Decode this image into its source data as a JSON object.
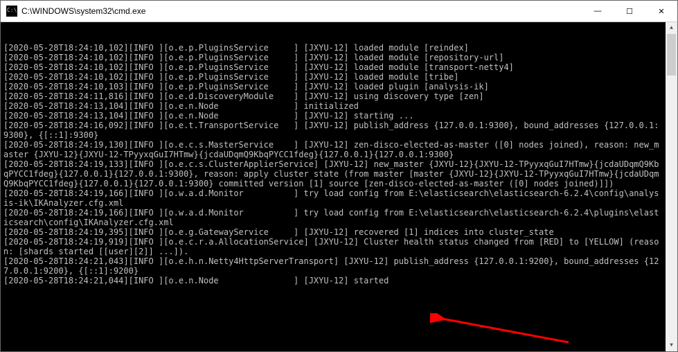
{
  "window": {
    "title": "C:\\WINDOWS\\system32\\cmd.exe",
    "controls": {
      "minimize": "—",
      "maximize": "☐",
      "close": "✕"
    }
  },
  "console": {
    "lines": [
      "[2020-05-28T18:24:10,102][INFO ][o.e.p.PluginsService     ] [JXYU-12] loaded module [reindex]",
      "[2020-05-28T18:24:10,102][INFO ][o.e.p.PluginsService     ] [JXYU-12] loaded module [repository-url]",
      "[2020-05-28T18:24:10,102][INFO ][o.e.p.PluginsService     ] [JXYU-12] loaded module [transport-netty4]",
      "[2020-05-28T18:24:10,102][INFO ][o.e.p.PluginsService     ] [JXYU-12] loaded module [tribe]",
      "[2020-05-28T18:24:10,103][INFO ][o.e.p.PluginsService     ] [JXYU-12] loaded plugin [analysis-ik]",
      "[2020-05-28T18:24:11,816][INFO ][o.e.d.DiscoveryModule    ] [JXYU-12] using discovery type [zen]",
      "[2020-05-28T18:24:13,104][INFO ][o.e.n.Node               ] initialized",
      "[2020-05-28T18:24:13,104][INFO ][o.e.n.Node               ] [JXYU-12] starting ...",
      "[2020-05-28T18:24:16,092][INFO ][o.e.t.TransportService   ] [JXYU-12] publish_address {127.0.0.1:9300}, bound_addresses {127.0.0.1:9300}, {[::1]:9300}",
      "[2020-05-28T18:24:19,130][INFO ][o.e.c.s.MasterService    ] [JXYU-12] zen-disco-elected-as-master ([0] nodes joined), reason: new_master {JXYU-12}{JXYU-12-TPyyxqGuI7HTmw}{jcdaUDqmQ9KbqPYCC1fdeg}{127.0.0.1}{127.0.0.1:9300}",
      "[2020-05-28T18:24:19,133][INFO ][o.e.c.s.ClusterApplierService] [JXYU-12] new_master {JXYU-12}{JXYU-12-TPyyxqGuI7HTmw}{jcdaUDqmQ9KbqPYCC1fdeg}{127.0.0.1}{127.0.0.1:9300}, reason: apply cluster state (from master [master {JXYU-12}{JXYU-12-TPyyxqGuI7HTmw}{jcdaUDqmQ9KbqPYCC1fdeg}{127.0.0.1}{127.0.0.1:9300} committed version [1] source [zen-disco-elected-as-master ([0] nodes joined)]])",
      "[2020-05-28T18:24:19,166][INFO ][o.w.a.d.Monitor          ] try load config from E:\\elasticsearch\\elasticsearch-6.2.4\\config\\analysis-ik\\IKAnalyzer.cfg.xml",
      "[2020-05-28T18:24:19,166][INFO ][o.w.a.d.Monitor          ] try load config from E:\\elasticsearch\\elasticsearch-6.2.4\\plugins\\elasticsearch\\config\\IKAnalyzer.cfg.xml",
      "[2020-05-28T18:24:19,395][INFO ][o.e.g.GatewayService     ] [JXYU-12] recovered [1] indices into cluster_state",
      "[2020-05-28T18:24:19,919][INFO ][o.e.c.r.a.AllocationService] [JXYU-12] Cluster health status changed from [RED] to [YELLOW] (reason: [shards started [[user][2]] ...]).",
      "[2020-05-28T18:24:21,043][INFO ][o.e.h.n.Netty4HttpServerTransport] [JXYU-12] publish_address {127.0.0.1:9200}, bound_addresses {127.0.0.1:9200}, {[::1]:9200}",
      "[2020-05-28T18:24:21,044][INFO ][o.e.n.Node               ] [JXYU-12] started"
    ]
  },
  "scrollbar": {
    "up": "▲",
    "down": "▼"
  },
  "arrow_color": "#ff0000"
}
